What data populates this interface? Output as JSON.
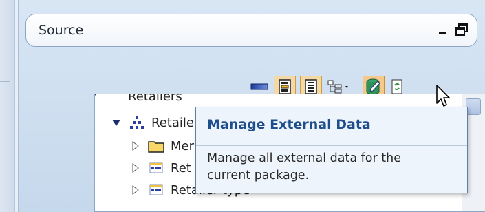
{
  "panel": {
    "title": "Source",
    "controls": {
      "minimize": "minimize-icon",
      "restore": "restore-icon"
    }
  },
  "toolbar": {
    "buttons": [
      {
        "icon": "eraser-icon",
        "state": "normal"
      },
      {
        "icon": "view-icon",
        "state": "toggled"
      },
      {
        "icon": "list-icon",
        "state": "toggled"
      },
      {
        "icon": "tree-options-icon",
        "state": "normal"
      },
      {
        "icon": "manage-external-data-icon",
        "state": "hover"
      },
      {
        "icon": "refresh-icon",
        "state": "normal"
      }
    ]
  },
  "tree": {
    "items": [
      {
        "label": "Retailers",
        "icon": "query-subject-icon",
        "expanded": true
      },
      {
        "label": "Retaile",
        "icon": "hierarchy-icon",
        "expanded": true
      },
      {
        "label": "Mer",
        "icon": "folder-icon",
        "expanded": false
      },
      {
        "label": "Ret",
        "icon": "level-icon",
        "expanded": false
      },
      {
        "label": "Retailer type",
        "icon": "level-icon",
        "expanded": false
      }
    ]
  },
  "tooltip": {
    "title": "Manage External Data",
    "line1": "Manage all external data for the",
    "line2": "current package."
  },
  "colors": {
    "accent": "#1f4e8c",
    "toggle_bg": "#f4d8a6",
    "hover_bg": "#f4c98a",
    "panel_bg": "#d8e6f4"
  }
}
